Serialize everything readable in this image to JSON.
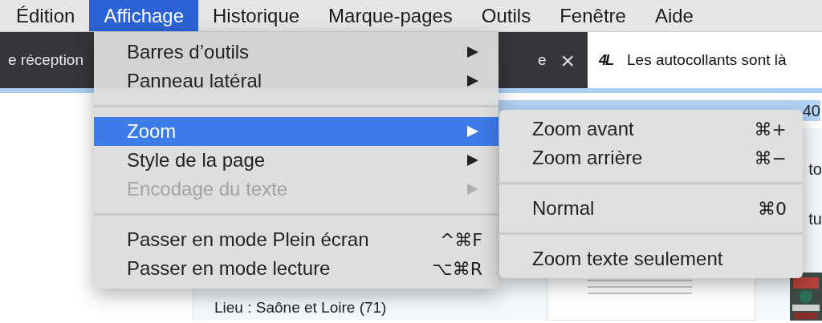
{
  "menu_bar": [
    {
      "label": "Édition",
      "selected": false
    },
    {
      "label": "Affichage",
      "selected": true
    },
    {
      "label": "Historique",
      "selected": false
    },
    {
      "label": "Marque-pages",
      "selected": false
    },
    {
      "label": "Outils",
      "selected": false
    },
    {
      "label": "Fenêtre",
      "selected": false
    },
    {
      "label": "Aide",
      "selected": false
    }
  ],
  "tabs": [
    {
      "label": "e réception",
      "selected": false,
      "closable": false
    },
    {
      "label": "e",
      "selected": false,
      "closable": true,
      "close": "×"
    },
    {
      "label": "Les autocollants sont là",
      "selected": true,
      "closable": false,
      "logo": "4L"
    }
  ],
  "address_bar": {
    "text": "40"
  },
  "page": {
    "fragments": [
      "to",
      "tu"
    ],
    "place": "Lieu : Saône et Loire (71)"
  },
  "menu": [
    {
      "kind": "item",
      "label": "Barres d’outils",
      "submenu": true,
      "disabled": false,
      "selected": false
    },
    {
      "kind": "item",
      "label": "Panneau latéral",
      "submenu": true,
      "disabled": false,
      "selected": false
    },
    {
      "kind": "separator"
    },
    {
      "kind": "item",
      "label": "Zoom",
      "submenu": true,
      "disabled": false,
      "selected": true
    },
    {
      "kind": "item",
      "label": "Style de la page",
      "submenu": true,
      "disabled": false,
      "selected": false
    },
    {
      "kind": "item",
      "label": "Encodage du texte",
      "submenu": true,
      "disabled": true,
      "selected": false
    },
    {
      "kind": "separator"
    },
    {
      "kind": "item",
      "label": "Passer en mode Plein écran",
      "shortcut": "^⌘F",
      "submenu": false,
      "disabled": false,
      "selected": false
    },
    {
      "kind": "item",
      "label": "Passer en mode lecture",
      "shortcut": "⌥⌘R",
      "submenu": false,
      "disabled": false,
      "selected": false
    }
  ],
  "submenu": [
    {
      "kind": "item",
      "label": "Zoom avant",
      "shortcut": "⌘+"
    },
    {
      "kind": "item",
      "label": "Zoom arrière",
      "shortcut": "⌘−"
    },
    {
      "kind": "separator"
    },
    {
      "kind": "item",
      "label": "Normal",
      "shortcut": "⌘0"
    },
    {
      "kind": "separator"
    },
    {
      "kind": "item",
      "label": "Zoom texte seulement"
    }
  ]
}
